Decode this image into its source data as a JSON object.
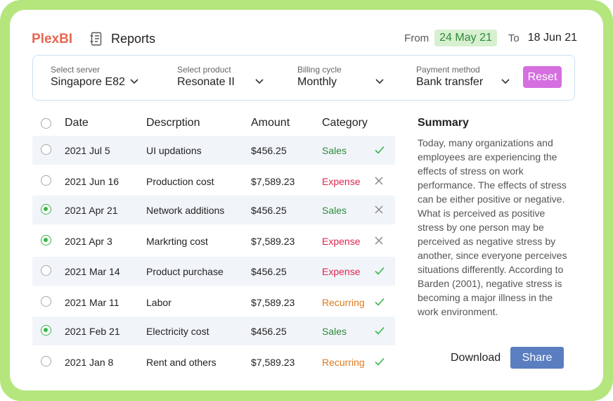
{
  "brand": "PlexBI",
  "header": {
    "title": "Reports",
    "icon": "report-document-icon",
    "from_label": "From",
    "from_date": "24 May 21",
    "to_label": "To",
    "to_date": "18 Jun 21"
  },
  "filters": {
    "server": {
      "label": "Select server",
      "value": "Singapore E82"
    },
    "product": {
      "label": "Select product",
      "value": "Resonate II"
    },
    "billing": {
      "label": "Billing cycle",
      "value": "Monthly"
    },
    "payment": {
      "label": "Payment method",
      "value": "Bank transfer"
    },
    "reset_label": "Reset"
  },
  "table": {
    "columns": {
      "date": "Date",
      "description": "Descrption",
      "amount": "Amount",
      "category": "Category"
    },
    "rows": [
      {
        "date": "2021 Jul 5",
        "description": "UI updations",
        "amount": "$456.25",
        "category": "Sales",
        "selected": false,
        "status": "check"
      },
      {
        "date": "2021 Jun 16",
        "description": "Production cost",
        "amount": "$7,589.23",
        "category": "Expense",
        "selected": false,
        "status": "cross"
      },
      {
        "date": "2021 Apr 21",
        "description": "Network additions",
        "amount": "$456.25",
        "category": "Sales",
        "selected": true,
        "status": "cross"
      },
      {
        "date": "2021 Apr 3",
        "description": "Markrting cost",
        "amount": "$7,589.23",
        "category": "Expense",
        "selected": true,
        "status": "cross"
      },
      {
        "date": "2021 Mar 14",
        "description": "Product purchase",
        "amount": "$456.25",
        "category": "Expense",
        "selected": false,
        "status": "check"
      },
      {
        "date": "2021 Mar 11",
        "description": "Labor",
        "amount": "$7,589.23",
        "category": "Recurring",
        "selected": false,
        "status": "check"
      },
      {
        "date": "2021 Feb 21",
        "description": "Electricity cost",
        "amount": "$456.25",
        "category": "Sales",
        "selected": true,
        "status": "check"
      },
      {
        "date": "2021 Jan 8",
        "description": "Rent and others",
        "amount": "$7,589.23",
        "category": "Recurring",
        "selected": false,
        "status": "check"
      }
    ]
  },
  "summary": {
    "title": "Summary",
    "text": "Today, many organizations and employees are experiencing the effects of stress on work performance. The effects of stress can be either positive or negative. What is perceived as positive stress by one person may be perceived as negative stress by another, since everyone perceives situations differently. According to Barden (2001), negative stress is becoming a major illness in the work environment."
  },
  "actions": {
    "download_label": "Download",
    "share_label": "Share"
  },
  "colors": {
    "brand": "#e8664f",
    "frame": "#b5e67e",
    "reset": "#d56fe0",
    "share": "#5b7ec0",
    "sales": "#2f8a3a",
    "expense": "#e0244f",
    "recurring": "#dd7a20",
    "check": "#3ab54a",
    "cross": "#8a8a8a"
  }
}
